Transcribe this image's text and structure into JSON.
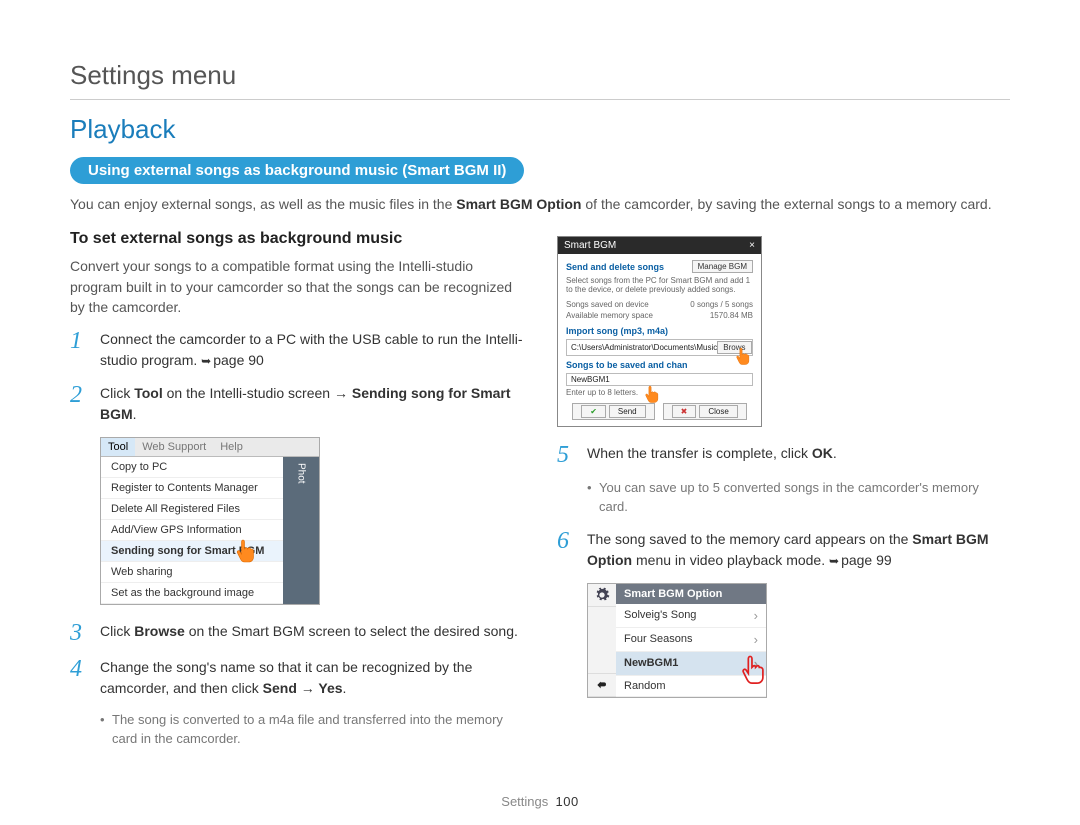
{
  "breadcrumb": "Settings menu",
  "section_title": "Playback",
  "pill": "Using external songs as background music (Smart BGM II)",
  "intro": {
    "pre": "You can enjoy external songs, as well as the music files in the ",
    "bold": "Smart BGM Option",
    "post": " of the camcorder, by saving the external songs to a memory card."
  },
  "subhead": "To set external songs as background music",
  "para1": "Convert your songs to a compatible format using the Intelli-studio program built in to your camcorder so that the songs can be recognized by the camcorder.",
  "steps_left": {
    "s1": {
      "num": "1",
      "text_pre": "Connect the camcorder to a PC with the USB cable to run the Intelli-studio program. ",
      "pageref": "page 90"
    },
    "s2": {
      "num": "2",
      "pre": "Click ",
      "b1": "Tool",
      "mid": " on the Intelli-studio screen → ",
      "b2": "Sending song for Smart BGM",
      "post": "."
    },
    "s3": {
      "num": "3",
      "pre": "Click ",
      "b1": "Browse",
      "post": " on the Smart BGM screen to select the desired song."
    },
    "s4": {
      "num": "4",
      "pre": "Change the song's name so that it can be recognized by the camcorder, and then click ",
      "b1": "Send",
      "arrow": " → ",
      "b2": "Yes",
      "post": ".",
      "bullet": "The song is converted to a m4a file and transferred into the memory card in the camcorder."
    }
  },
  "steps_right": {
    "s5": {
      "num": "5",
      "pre": "When the transfer is complete, click ",
      "b1": "OK",
      "post": ".",
      "bullet": "You can save up to 5 converted songs in the camcorder's memory card."
    },
    "s6": {
      "num": "6",
      "pre": "The song saved to the memory card appears on the ",
      "b1": "Smart BGM Option",
      "post": " menu in video playback mode. ",
      "pageref": "page 99"
    }
  },
  "tool_menu": {
    "tabs": [
      "Tool",
      "Web Support",
      "Help"
    ],
    "items": [
      "Copy to PC",
      "Register to Contents Manager",
      "Delete All Registered Files",
      "Add/View GPS Information",
      "Sending song for Smart BGM",
      "Web sharing",
      "Set as the background image"
    ],
    "side": "Phot"
  },
  "dlg": {
    "title": "Smart BGM",
    "close": "×",
    "h1": "Send and delete songs",
    "manage": "Manage BGM",
    "sub1": "Select songs from the PC for Smart BGM and add 1 to the device, or delete previously added songs.",
    "row1_l": "Songs saved on device",
    "row1_r": "0 songs / 5 songs",
    "row2_l": "Available memory space",
    "row2_r": "1570.84 MB",
    "h2": "Import song (mp3, m4a)",
    "path": "C:\\Users\\Administrator\\Documents\\Music",
    "browse": "Brows",
    "h3": "Songs to be saved and chan",
    "newname": "NewBGM1",
    "hint": "Enter up to 8 letters.",
    "send": "Send",
    "close_btn": "Close"
  },
  "cam": {
    "title": "Smart BGM Option",
    "rows": [
      "Solveig's Song",
      "Four Seasons",
      "NewBGM1",
      "Random"
    ]
  },
  "footer": {
    "label": "Settings",
    "page": "100"
  }
}
